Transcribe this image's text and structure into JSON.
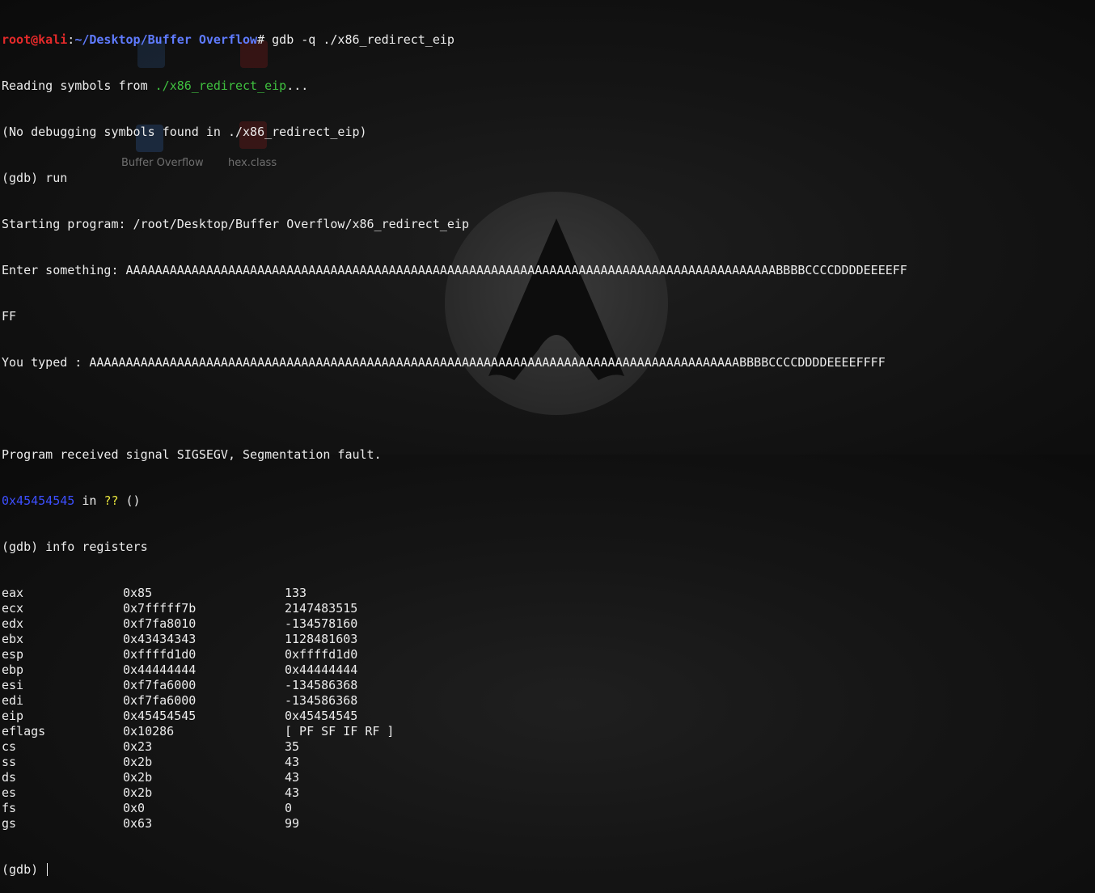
{
  "desktop": {
    "icons": [
      {
        "icon": "python-file-icon",
        "label": ""
      },
      {
        "icon": "java-file-icon",
        "label": ""
      },
      {
        "icon": "folder-icon",
        "label": "Buffer Overflow"
      },
      {
        "icon": "java-class-icon",
        "label": "hex.class"
      }
    ],
    "logo": "kali-logo"
  },
  "terminal": {
    "prompt_user": "root@kali",
    "prompt_sep": ":",
    "prompt_path": "~/Desktop/Buffer Overflow",
    "prompt_hash": "# ",
    "command": "gdb -q ./x86_redirect_eip",
    "reading_prefix": "Reading symbols from ",
    "reading_file": "./x86_redirect_eip",
    "reading_suffix": "...",
    "no_debug": "(No debugging symbols found in ./x86_redirect_eip)",
    "run_cmd": "(gdb) run",
    "starting": "Starting program: /root/Desktop/Buffer Overflow/x86_redirect_eip",
    "enter_line1": "Enter something: AAAAAAAAAAAAAAAAAAAAAAAAAAAAAAAAAAAAAAAAAAAAAAAAAAAAAAAAAAAAAAAAAAAAAAAAAAAAAAAAAAAAAAAAABBBBCCCCDDDDEEEEFF",
    "enter_line2": "FF",
    "typed": "You typed : AAAAAAAAAAAAAAAAAAAAAAAAAAAAAAAAAAAAAAAAAAAAAAAAAAAAAAAAAAAAAAAAAAAAAAAAAAAAAAAAAAAAAAAAABBBBCCCCDDDDEEEEFFFF",
    "signal": "Program received signal SIGSEGV, Segmentation fault.",
    "fault_addr": "0x45454545",
    "fault_in": " in ",
    "fault_func": "??",
    "fault_parens": " ()",
    "info_cmd": "(gdb) info registers",
    "registers": [
      {
        "name": "eax",
        "hex": "0x85",
        "value": "133"
      },
      {
        "name": "ecx",
        "hex": "0x7fffff7b",
        "value": "2147483515"
      },
      {
        "name": "edx",
        "hex": "0xf7fa8010",
        "value": "-134578160"
      },
      {
        "name": "ebx",
        "hex": "0x43434343",
        "value": "1128481603"
      },
      {
        "name": "esp",
        "hex": "0xffffd1d0",
        "value": "0xffffd1d0"
      },
      {
        "name": "ebp",
        "hex": "0x44444444",
        "value": "0x44444444"
      },
      {
        "name": "esi",
        "hex": "0xf7fa6000",
        "value": "-134586368"
      },
      {
        "name": "edi",
        "hex": "0xf7fa6000",
        "value": "-134586368"
      },
      {
        "name": "eip",
        "hex": "0x45454545",
        "value": "0x45454545"
      },
      {
        "name": "eflags",
        "hex": "0x10286",
        "value": "[ PF SF IF RF ]"
      },
      {
        "name": "cs",
        "hex": "0x23",
        "value": "35"
      },
      {
        "name": "ss",
        "hex": "0x2b",
        "value": "43"
      },
      {
        "name": "ds",
        "hex": "0x2b",
        "value": "43"
      },
      {
        "name": "es",
        "hex": "0x2b",
        "value": "43"
      },
      {
        "name": "fs",
        "hex": "0x0",
        "value": "0"
      },
      {
        "name": "gs",
        "hex": "0x63",
        "value": "99"
      }
    ],
    "final_prompt": "(gdb) "
  },
  "colors": {
    "background": "#151515",
    "text": "#ececec",
    "prompt_user": "#e52a2a",
    "prompt_path": "#5f7bff",
    "filename": "#3fc03f",
    "address": "#3d4fff",
    "function": "#e9e63d"
  }
}
